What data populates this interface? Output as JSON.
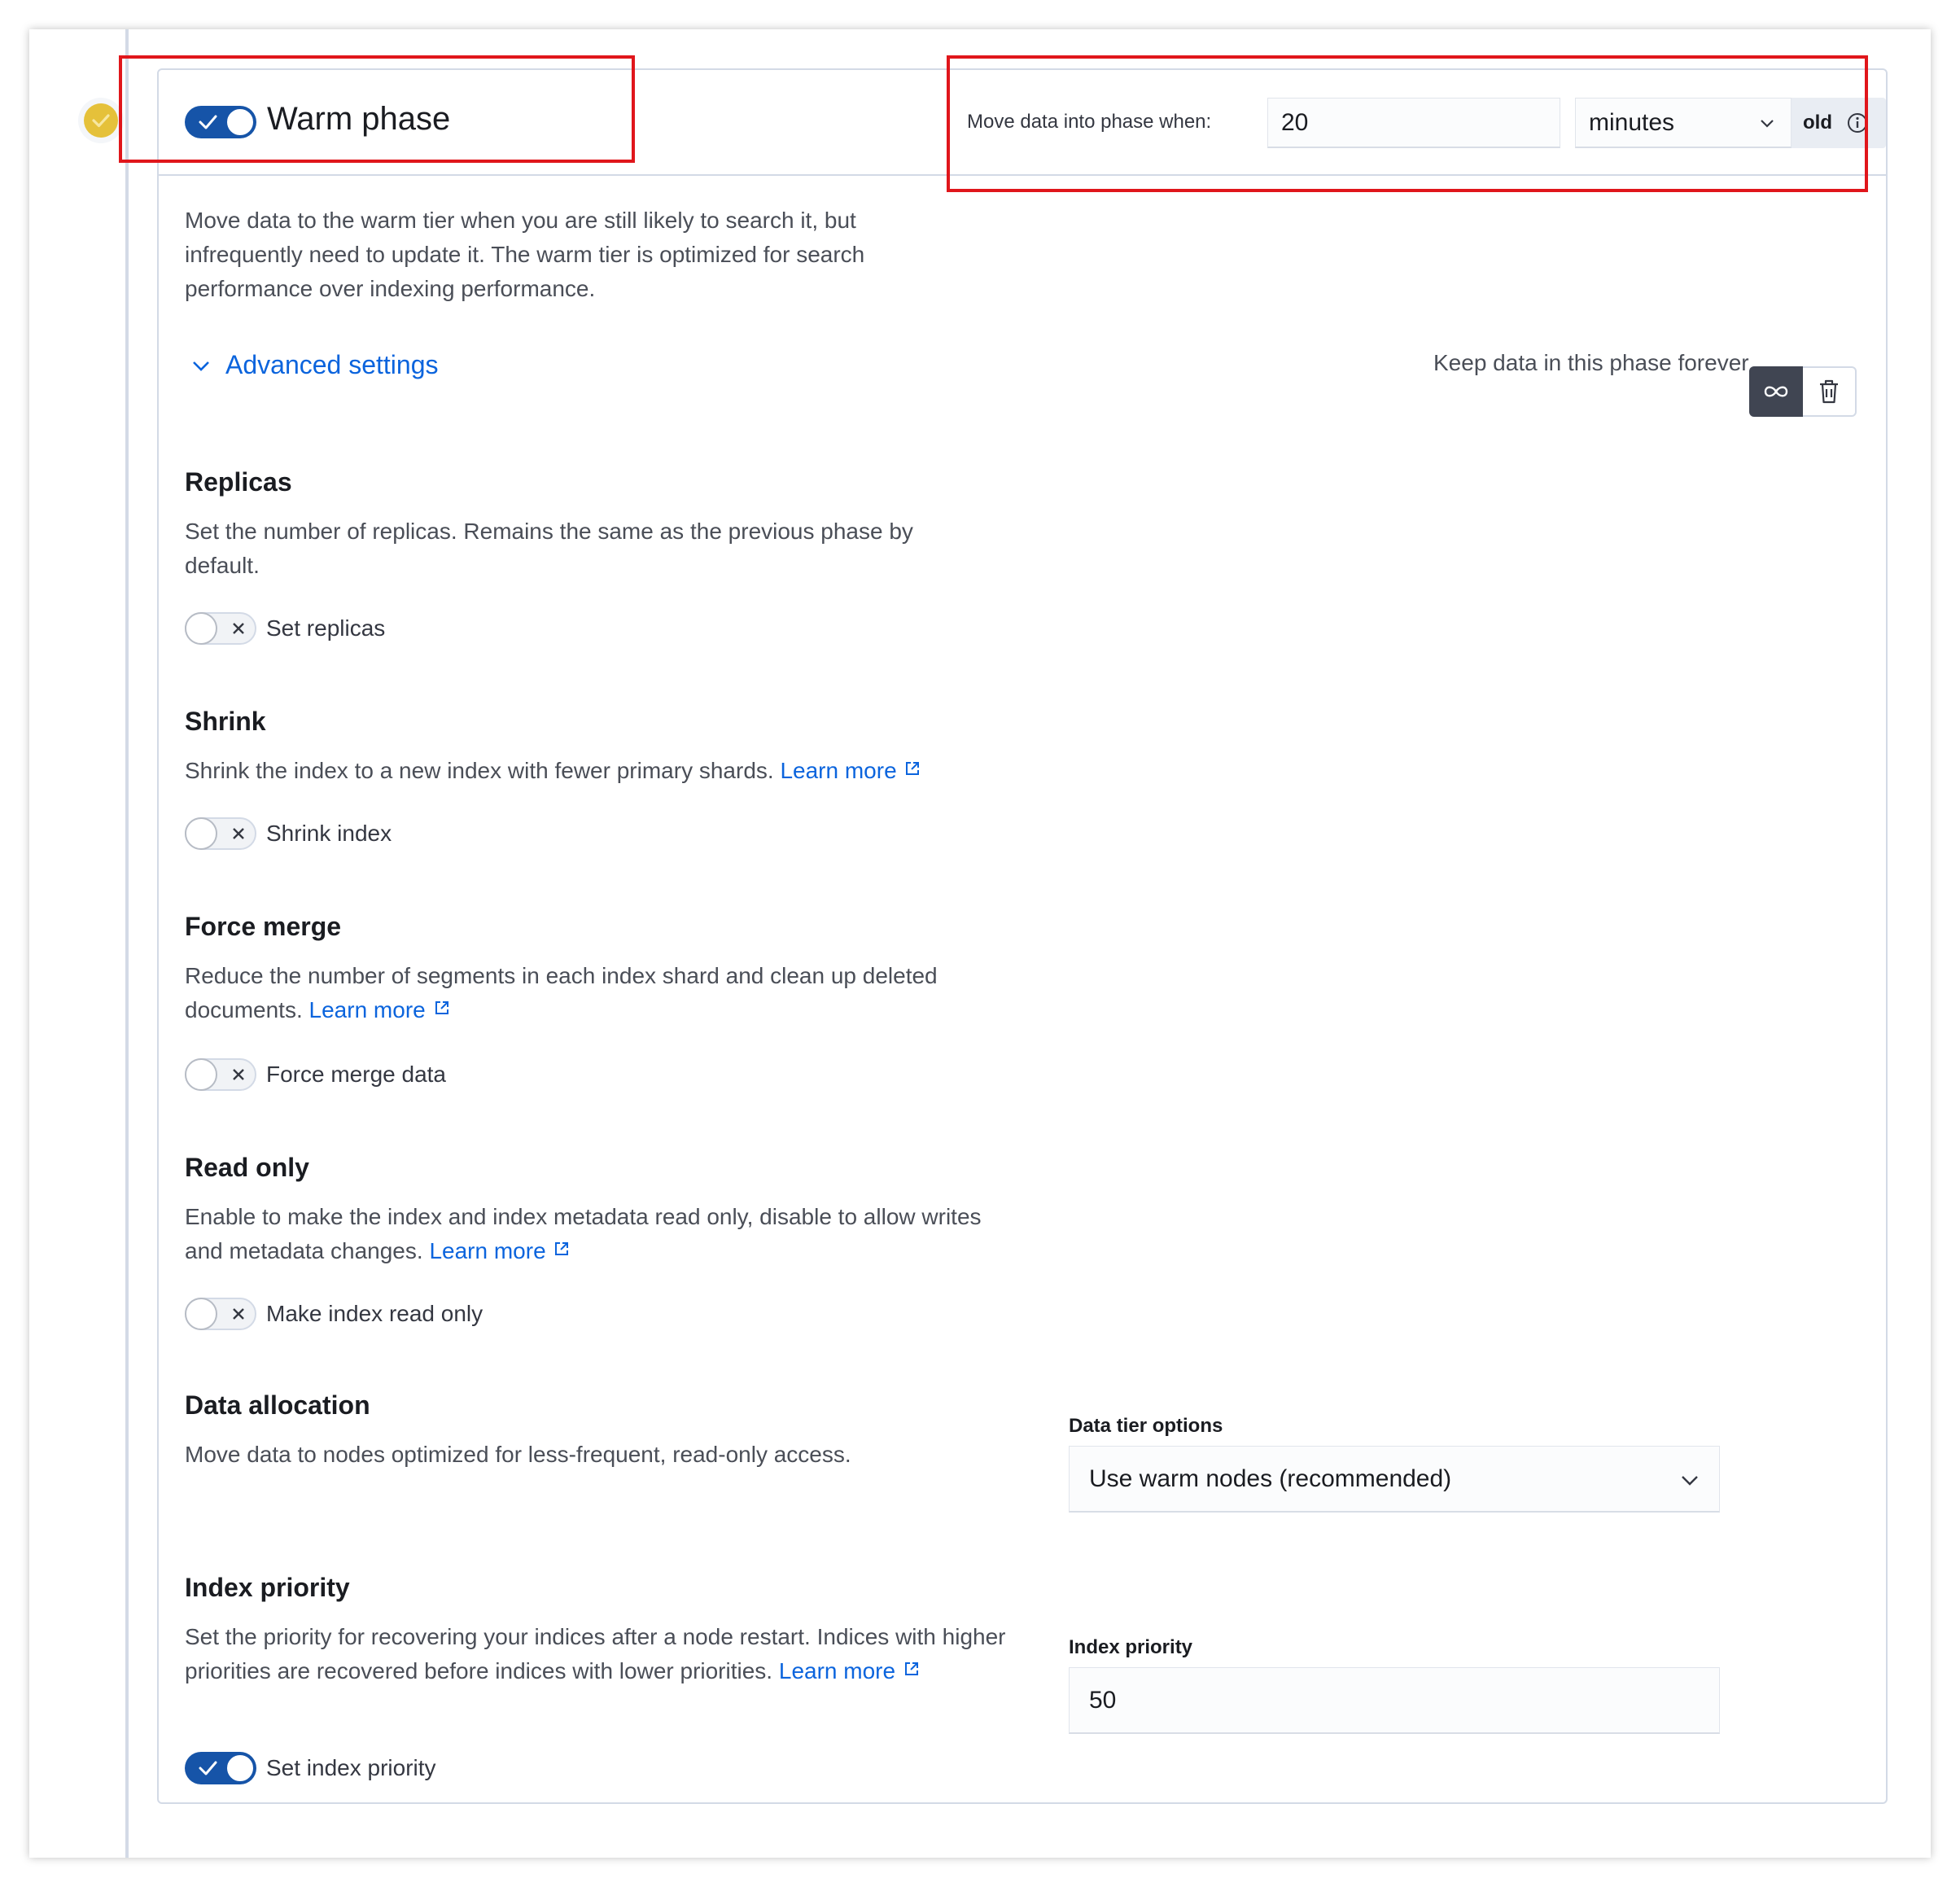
{
  "phase": {
    "title": "Warm phase",
    "enabled": true,
    "move_label": "Move data into phase when:",
    "age_value": "20",
    "age_unit": "minutes",
    "age_suffix": "old",
    "description": "Move data to the warm tier when you are still likely to search it, but infrequently need to update it. The warm tier is optimized for search performance over indexing performance."
  },
  "advanced": {
    "label": "Advanced settings",
    "keep_forever_label": "Keep data in this phase forever",
    "icons": [
      "infinity-icon",
      "trash-icon"
    ]
  },
  "replicas": {
    "title": "Replicas",
    "description": "Set the number of replicas. Remains the same as the previous phase by default.",
    "toggle_label": "Set replicas",
    "enabled": false
  },
  "shrink": {
    "title": "Shrink",
    "description": "Shrink the index to a new index with fewer primary shards.",
    "link": "Learn more",
    "toggle_label": "Shrink index",
    "enabled": false
  },
  "force_merge": {
    "title": "Force merge",
    "description": "Reduce the number of segments in each index shard and clean up deleted documents.",
    "link": "Learn more",
    "toggle_label": "Force merge data",
    "enabled": false
  },
  "read_only": {
    "title": "Read only",
    "description": "Enable to make the index and index metadata read only, disable to allow writes and metadata changes.",
    "link": "Learn more",
    "toggle_label": "Make index read only",
    "enabled": false
  },
  "data_allocation": {
    "title": "Data allocation",
    "description": "Move data to nodes optimized for less-frequent, read-only access.",
    "select_label": "Data tier options",
    "select_value": "Use warm nodes (recommended)"
  },
  "index_priority": {
    "title": "Index priority",
    "description": "Set the priority for recovering your indices after a node restart. Indices with higher priorities are recovered before indices with lower priorities.",
    "link": "Learn more",
    "field_label": "Index priority",
    "value": "50",
    "toggle_label": "Set index priority",
    "enabled": true
  },
  "colors": {
    "accent": "#1654a8",
    "link": "#0b64dd",
    "highlight_box": "#e0161b",
    "phase_dot": "#e5c13a"
  }
}
